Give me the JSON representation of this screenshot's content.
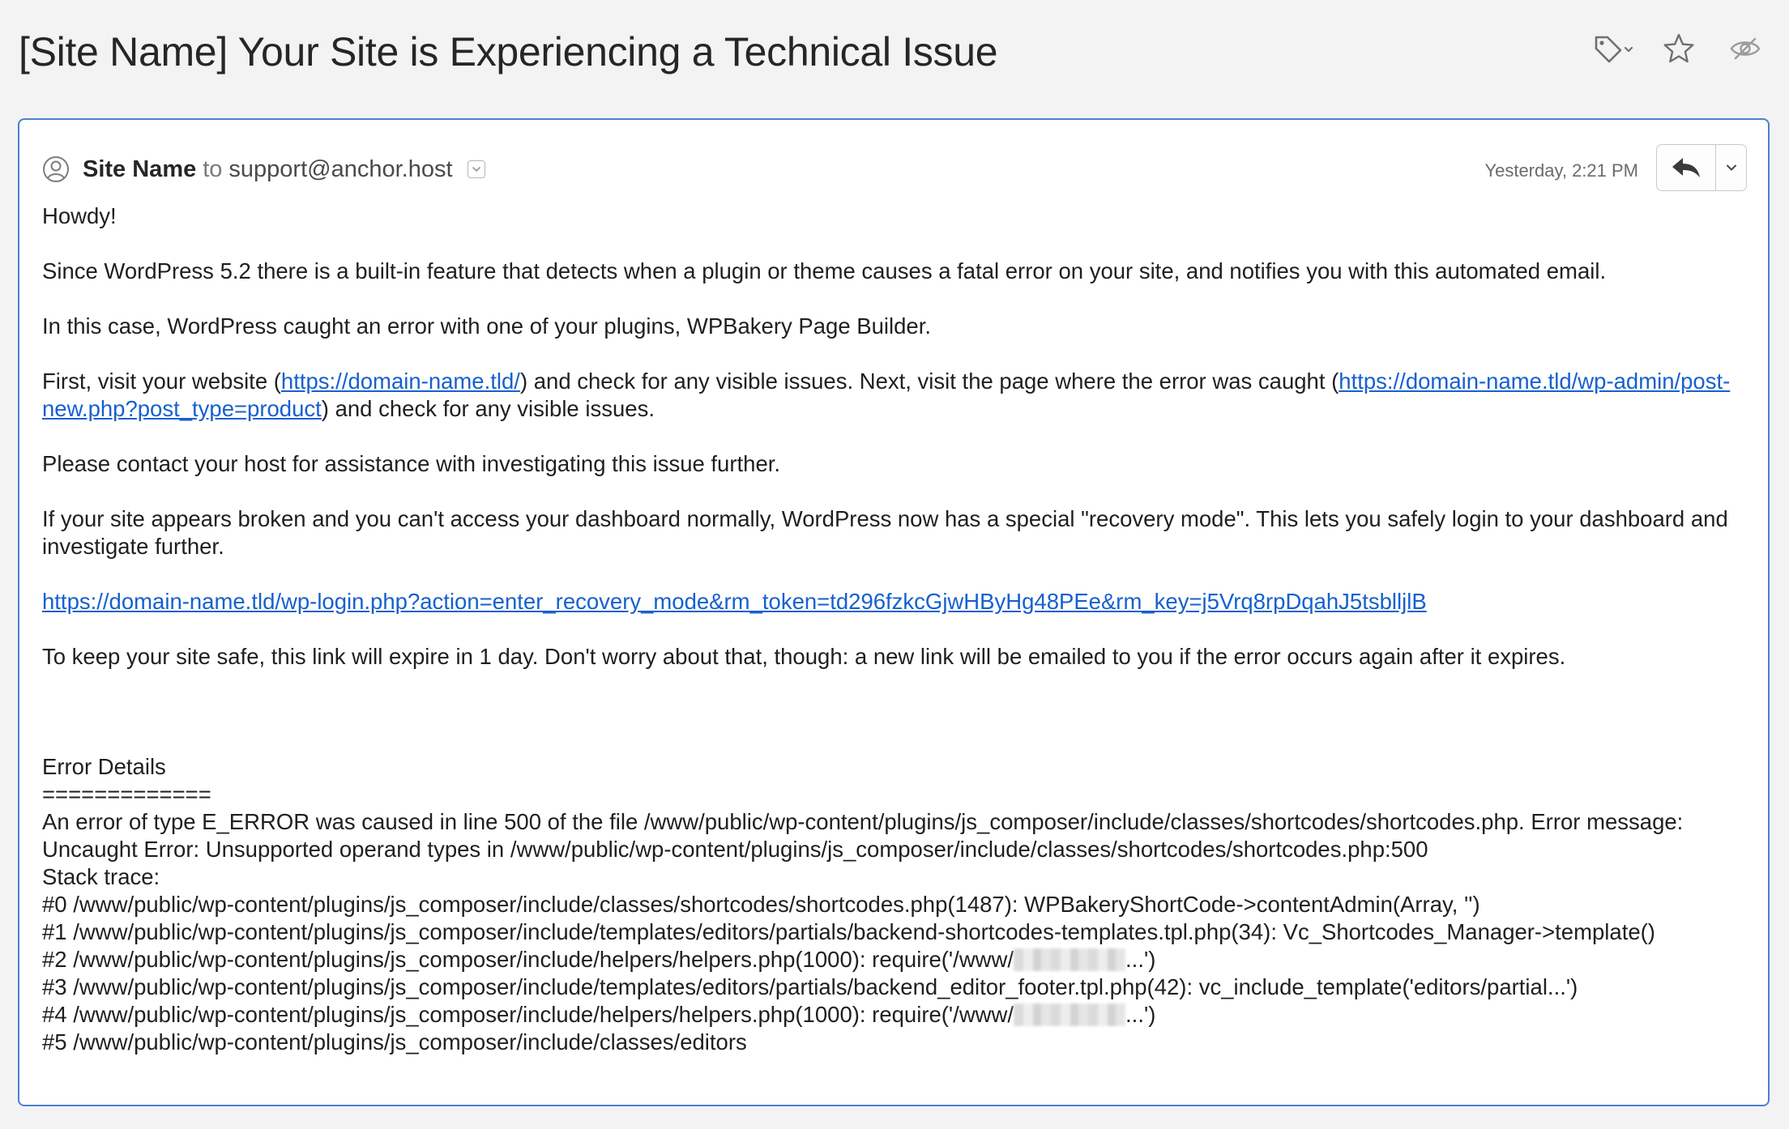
{
  "subject": "[Site Name] Your Site is Experiencing a Technical Issue",
  "toolbar": {
    "tag_icon": "tag-icon",
    "star_icon": "star-icon",
    "watch_icon": "eye-icon"
  },
  "message": {
    "sender_name": "Site Name",
    "to_word": "to",
    "recipient": "support@anchor.host",
    "timestamp": "Yesterday, 2:21 PM",
    "reply_icon": "reply-icon",
    "more_icon": "chevron-down-icon"
  },
  "body": {
    "greeting": "Howdy!",
    "p1": "Since WordPress 5.2 there is a built-in feature that detects when a plugin or theme causes a fatal error on your site, and notifies you with this automated email.",
    "p2": "In this case, WordPress caught an error with one of your plugins, WPBakery Page Builder.",
    "p3_a": "First, visit your website (",
    "p3_link1": "https://domain-name.tld/",
    "p3_b": ") and check for any visible issues. Next, visit the page where the error was caught (",
    "p3_link2": "https://domain-name.tld/wp-admin/post-new.php?post_type=product",
    "p3_c": ") and check for any visible issues.",
    "p4": "Please contact your host for assistance with investigating this issue further.",
    "p5": "If your site appears broken and you can't access your dashboard normally, WordPress now has a special \"recovery mode\". This lets you safely login to your dashboard and investigate further.",
    "recovery_link": "https://domain-name.tld/wp-login.php?action=enter_recovery_mode&rm_token=td296fzkcGjwHByHg48PEe&rm_key=j5Vrq8rpDqahJ5tsblljlB",
    "p6": "To keep your site safe, this link will expire in 1 day. Don't worry about that, though: a new link will be emailed to you if the error occurs again after it expires.",
    "error_heading": "Error Details",
    "error_rule": "=============",
    "error_message": "An error of type E_ERROR was caused in line 500 of the file /www/public/wp-content/plugins/js_composer/include/classes/shortcodes/shortcodes.php. Error message: Uncaught Error: Unsupported operand types in /www/public/wp-content/plugins/js_composer/include/classes/shortcodes/shortcodes.php:500",
    "stack_label": "Stack trace:",
    "trace0": "#0 /www/public/wp-content/plugins/js_composer/include/classes/shortcodes/shortcodes.php(1487): WPBakeryShortCode->contentAdmin(Array, '')",
    "trace1": "#1 /www/public/wp-content/plugins/js_composer/include/templates/editors/partials/backend-shortcodes-templates.tpl.php(34): Vc_Shortcodes_Manager->template()",
    "trace2_a": "#2 /www/public/wp-content/plugins/js_composer/include/helpers/helpers.php(1000): require('/www/",
    "trace2_b": "...')",
    "trace3": "#3 /www/public/wp-content/plugins/js_composer/include/templates/editors/partials/backend_editor_footer.tpl.php(42): vc_include_template('editors/partial...')",
    "trace4_a": "#4 /www/public/wp-content/plugins/js_composer/include/helpers/helpers.php(1000): require('/www/",
    "trace4_b": "...')",
    "trace5": "#5 /www/public/wp-content/plugins/js_composer/include/classes/editors"
  },
  "colors": {
    "link": "#1660cf",
    "card_border": "#4a7fd4",
    "background": "#f3f3f3"
  }
}
